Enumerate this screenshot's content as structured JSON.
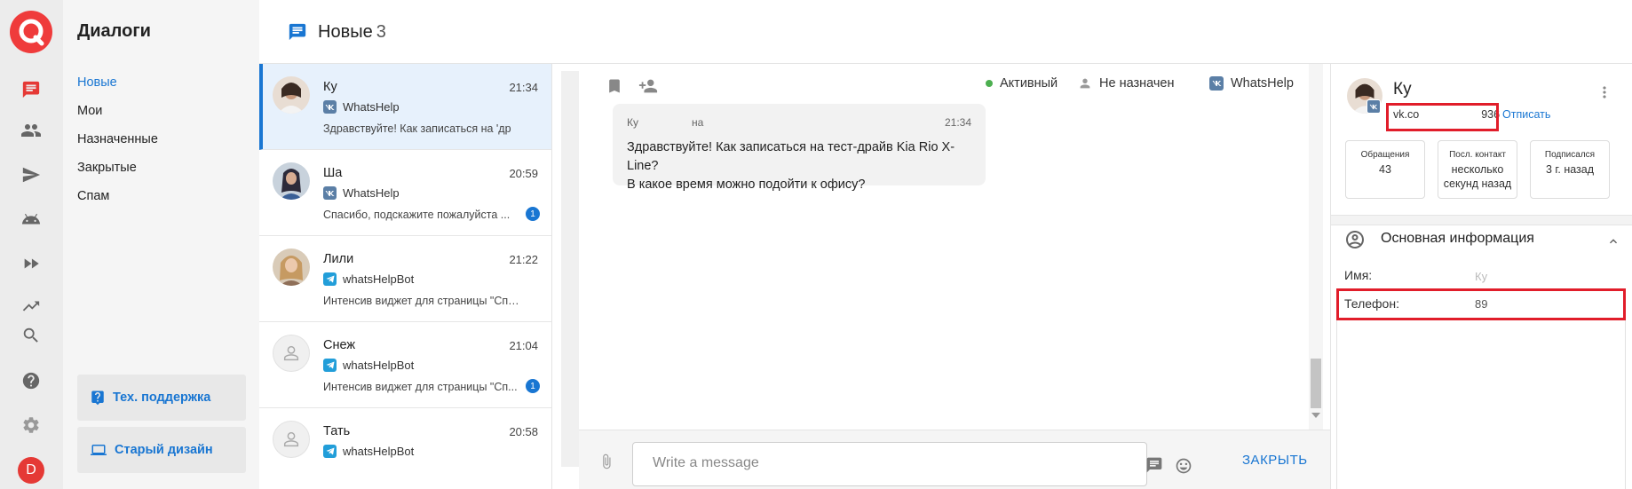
{
  "sidebar": {
    "title": "Диалоги",
    "folders": [
      {
        "label": "Новые"
      },
      {
        "label": "Мои"
      },
      {
        "label": "Назначенные"
      },
      {
        "label": "Закрытые"
      },
      {
        "label": "Спам"
      }
    ],
    "support_label": "Тех. поддержка",
    "old_design_label": "Старый дизайн",
    "user_initial": "D"
  },
  "header": {
    "title": "Новые",
    "count": "3"
  },
  "dialogs": [
    {
      "name": "Ку",
      "time": "21:34",
      "channel": "WhatsHelp",
      "channel_type": "vk",
      "preview": "Здравствуйте! Как записаться на 'др",
      "unread": "",
      "active": true
    },
    {
      "name": "Ша",
      "time": "20:59",
      "channel": "WhatsHelp",
      "channel_type": "vk",
      "preview": "Спасибо, подскажите пожалуйста ...",
      "unread": "1",
      "active": false
    },
    {
      "name": "Лили",
      "time": "21:22",
      "channel": "whatsHelpBot",
      "channel_type": "telegram",
      "preview": "Интенсив виджет для страницы \"Спас...",
      "unread": "",
      "active": false
    },
    {
      "name": "Снеж",
      "time": "21:04",
      "channel": "whatsHelpBot",
      "channel_type": "telegram",
      "preview": "Интенсив виджет для страницы \"Сп...",
      "unread": "1",
      "active": false
    },
    {
      "name": "Тать",
      "time": "20:58",
      "channel": "whatsHelpBot",
      "channel_type": "telegram",
      "preview": "",
      "unread": "",
      "active": false
    }
  ],
  "chat": {
    "status": "Активный",
    "assignee": "Не назначен",
    "channel": "WhatsHelp",
    "message": {
      "author": "Ку",
      "author_suffix": "на",
      "time": "21:34",
      "line1": "Здравствуйте! Как записаться на тест-драйв Kia Rio X-Line?",
      "line2": "В какое время можно подойти к офису?"
    },
    "composer_placeholder": "Write a message",
    "close_label": "ЗАКРЫТЬ"
  },
  "client": {
    "name": "Ку",
    "link_prefix": "vk.co",
    "link_suffix": "936",
    "unsubscribe_label": "Отписать",
    "stats": [
      {
        "label": "Обращения",
        "value": "43"
      },
      {
        "label": "Посл. контакт",
        "value": "несколько секунд назад"
      },
      {
        "label": "Подписался",
        "value": "3 г. назад"
      }
    ],
    "section_title": "Основная информация",
    "fields": [
      {
        "label": "Имя:",
        "value": "Ку"
      },
      {
        "label": "Телефон:",
        "value": "89"
      }
    ]
  },
  "colors": {
    "accent": "#1976d2",
    "brand": "#ef3b3b",
    "highlight": "#e11d2a",
    "status_active": "#4caf50"
  }
}
